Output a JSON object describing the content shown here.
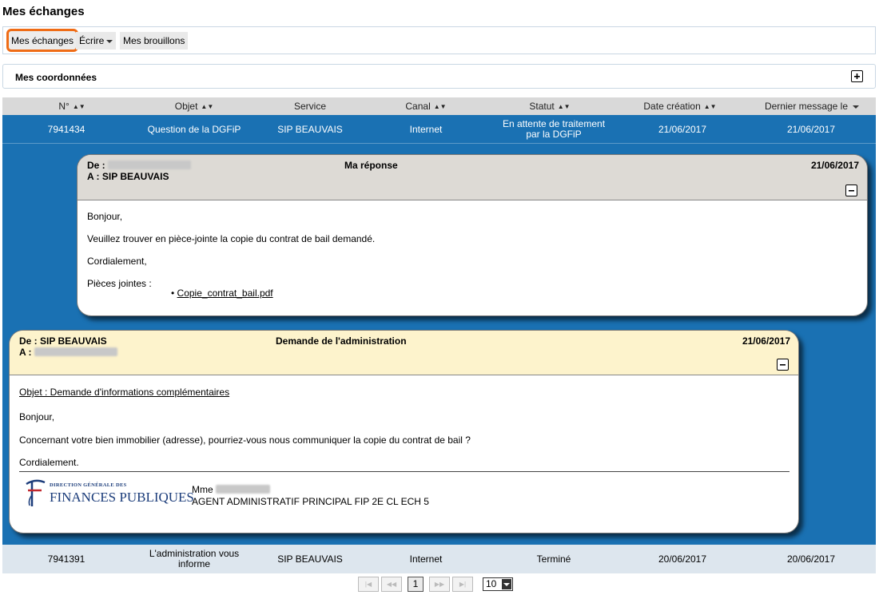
{
  "page_title": "Mes échanges",
  "toolbar": {
    "mes_echanges": "Mes échanges",
    "ecrire": "Écrire",
    "brouillons": "Mes brouillons"
  },
  "coordonnees": {
    "title": "Mes coordonnées"
  },
  "table": {
    "headers": [
      "N°",
      "Objet",
      "Service",
      "Canal",
      "Statut",
      "Date création",
      "Dernier message le"
    ],
    "rows": [
      {
        "num": "7941434",
        "objet": "Question de la DGFiP",
        "service": "SIP BEAUVAIS",
        "canal": "Internet",
        "statut_line1": "En attente de traitement",
        "statut_line2": "par la DGFiP",
        "date_creation": "21/06/2017",
        "dernier_message": "21/06/2017"
      },
      {
        "num": "7941391",
        "objet_line1": "L'administration vous",
        "objet_line2": "informe",
        "service": "SIP BEAUVAIS",
        "canal": "Internet",
        "statut": "Terminé",
        "date_creation": "20/06/2017",
        "dernier_message": "20/06/2017"
      }
    ]
  },
  "message_reply": {
    "de_label": "De :",
    "a_line": "A : SIP BEAUVAIS",
    "title": "Ma réponse",
    "date": "21/06/2017",
    "greeting": "Bonjour,",
    "body": "Veuillez trouver en pièce-jointe la copie du contrat de bail demandé.",
    "closing": "Cordialement,",
    "attachments_label": "Pièces jointes :",
    "attachment": "Copie_contrat_bail.pdf"
  },
  "message_admin": {
    "de_line": "De : SIP BEAUVAIS",
    "a_label": "A :",
    "title": "Demande de l'administration",
    "date": "21/06/2017",
    "objet": "Objet : Demande d'informations complémentaires",
    "greeting": "Bonjour,",
    "body": "Concernant votre bien immobilier (adresse), pourriez-vous nous communiquer la copie du contrat de bail ?",
    "closing": "Cordialement.",
    "logo_line1": "DIRECTION GÉNÉRALE DES",
    "logo_line2": "FINANCES PUBLIQUES",
    "sig_title": "Mme",
    "sig_role": "AGENT ADMINISTRATIF PRINCIPAL FIP 2E CL ECH 5"
  },
  "pagination": {
    "first": "|◀",
    "prev": "◀◀",
    "current": "1",
    "next": "▶▶",
    "last": "▶|",
    "page_size": "10"
  },
  "colors": {
    "selected_row": "#1a71b3",
    "highlight": "#ef6c16",
    "admin_header": "#fdf3cc",
    "reply_header": "#dddad5"
  }
}
